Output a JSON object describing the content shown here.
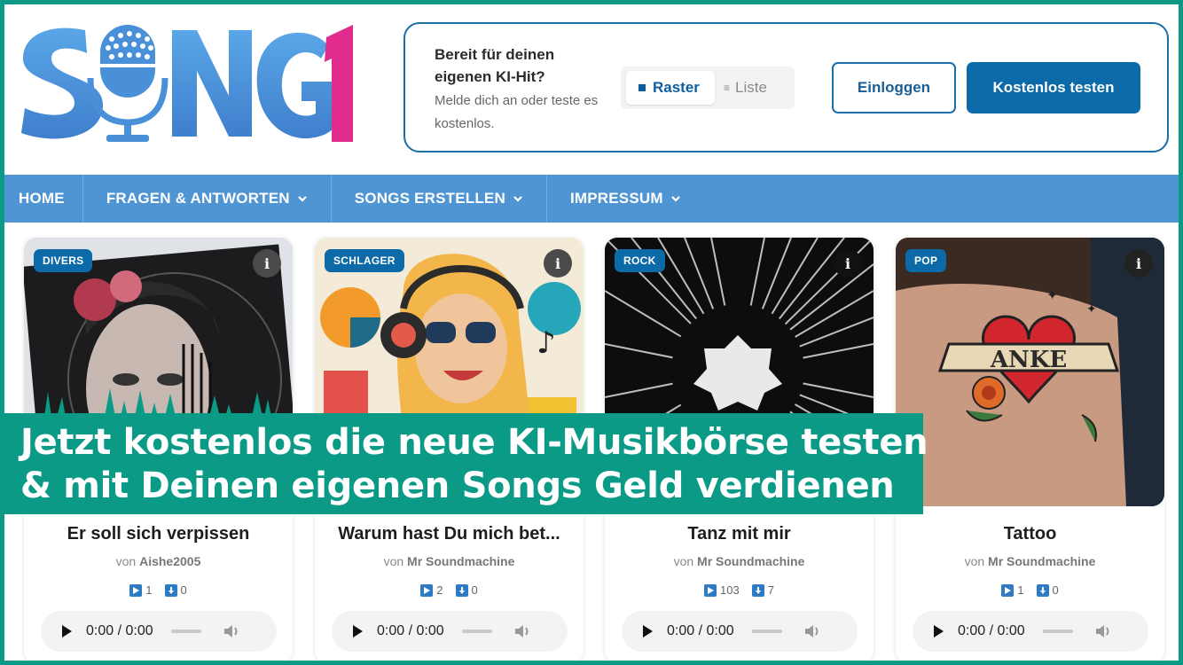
{
  "logo": {
    "text": "SONG1",
    "colors": {
      "blue": "#4a90d9",
      "pink": "#e22b8f"
    }
  },
  "promo": {
    "heading": "Bereit für deinen eigenen KI-Hit?",
    "subtext": "Melde dich an oder teste es kostenlos.",
    "view_toggle": {
      "grid_label": "Raster",
      "list_label": "Liste",
      "selected": "Raster"
    },
    "login_label": "Einloggen",
    "try_label": "Kostenlos testen"
  },
  "nav": {
    "items": [
      {
        "label": "HOME",
        "has_dropdown": false
      },
      {
        "label": "FRAGEN & ANTWORTEN",
        "has_dropdown": true
      },
      {
        "label": "SONGS ERSTELLEN",
        "has_dropdown": true
      },
      {
        "label": "IMPRESSUM",
        "has_dropdown": true
      }
    ]
  },
  "songs": [
    {
      "genre": "DIVERS",
      "title": "Er soll sich verpissen",
      "by": "von",
      "author": "Aishe2005",
      "plays": "1",
      "downloads": "0",
      "time": "0:00 / 0:00"
    },
    {
      "genre": "SCHLAGER",
      "title": "Warum hast Du mich bet...",
      "by": "von",
      "author": "Mr Soundmachine",
      "plays": "2",
      "downloads": "0",
      "time": "0:00 / 0:00"
    },
    {
      "genre": "ROCK",
      "title": "Tanz mit mir",
      "by": "von",
      "author": "Mr Soundmachine",
      "plays": "103",
      "downloads": "7",
      "time": "0:00 / 0:00"
    },
    {
      "genre": "POP",
      "title": "Tattoo",
      "by": "von",
      "author": "Mr Soundmachine",
      "plays": "1",
      "downloads": "0",
      "time": "0:00 / 0:00"
    }
  ],
  "banner": {
    "line1": "Jetzt kostenlos die neue KI-Musikbörse testen",
    "line2": "& mit Deinen eigenen Songs Geld verdienen",
    "color": "#0b9a86"
  },
  "tattoo_text": "ANKE",
  "accent": "#0d6aa8"
}
